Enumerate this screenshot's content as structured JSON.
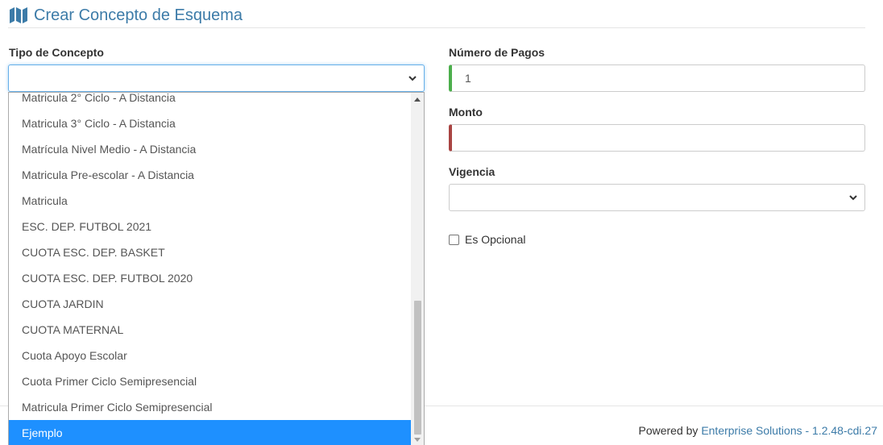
{
  "header": {
    "title": "Crear Concepto de Esquema",
    "icon": "map-icon"
  },
  "form": {
    "tipo_label": "Tipo de Concepto",
    "tipo_value": "",
    "pagos_label": "Número de Pagos",
    "pagos_value": "1",
    "monto_label": "Monto",
    "monto_value": "",
    "vigencia_label": "Vigencia",
    "vigencia_value": "",
    "opcional_label": "Es Opcional",
    "opcional_checked": false
  },
  "dropdown": {
    "options": [
      "Matricula 2° Ciclo - A Distancia",
      "Matricula 3° Ciclo - A Distancia",
      "Matrícula Nivel Medio - A Distancia",
      "Matricula Pre-escolar - A Distancia",
      "Matricula",
      "ESC. DEP. FUTBOL 2021",
      "CUOTA ESC. DEP. BASKET",
      "CUOTA ESC. DEP. FUTBOL 2020",
      "CUOTA JARDIN",
      "CUOTA MATERNAL",
      "Cuota Apoyo Escolar",
      "Cuota Primer Ciclo Semipresencial",
      "Matricula Primer Ciclo Semipresencial",
      "Ejemplo"
    ],
    "highlighted": "Ejemplo"
  },
  "footer": {
    "prefix": "Powered by ",
    "brand": "Enterprise Solutions - 1.2.48-cdi.27"
  },
  "colors": {
    "accent": "#3c7ba8",
    "highlight": "#1e90ff",
    "success": "#4cae4c",
    "error": "#a94442"
  }
}
